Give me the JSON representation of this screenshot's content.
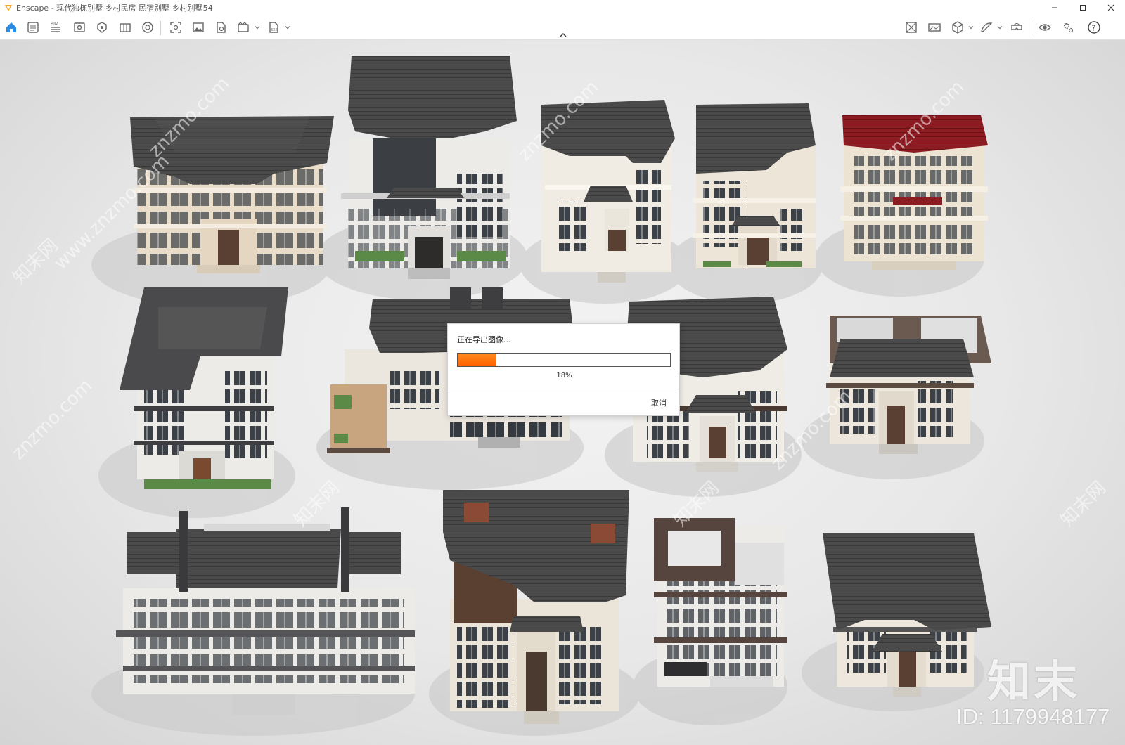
{
  "app": {
    "title": "Enscape - 现代独栋别墅 乡村民房 民宿别墅 乡村别墅54",
    "accent_color": "#f5a623"
  },
  "toolbar": {
    "left_tools": [
      {
        "icon": "home-icon"
      },
      {
        "icon": "asset-library-icon"
      },
      {
        "icon": "bim-icon"
      },
      {
        "icon": "view-management-icon"
      },
      {
        "icon": "capture-icon"
      },
      {
        "icon": "batch-rendering-icon"
      },
      {
        "icon": "materials-icon"
      },
      {
        "icon": "screenshot-icon"
      },
      {
        "icon": "image-gallery-icon"
      },
      {
        "icon": "export-file-icon"
      },
      {
        "icon": "video-export-icon"
      },
      {
        "icon": "exe-export-icon"
      }
    ],
    "right_tools": [
      {
        "icon": "map-view-icon"
      },
      {
        "icon": "panorama-icon"
      },
      {
        "icon": "cube-view-icon"
      },
      {
        "icon": "sketch-icon"
      },
      {
        "icon": "vr-headset-icon"
      },
      {
        "icon": "visibility-icon"
      },
      {
        "icon": "settings-icon"
      },
      {
        "icon": "help-icon"
      }
    ]
  },
  "dialog": {
    "title": "正在导出图像...",
    "progress": 0.18,
    "progress_label": "18%",
    "cancel_label": "取消"
  },
  "watermarks": {
    "site": "znzmo.com",
    "site_full": "www.znzmo.com",
    "cn": "知末网"
  },
  "brand": {
    "logo_text": "知末",
    "id_text": "ID: 1179948177"
  }
}
